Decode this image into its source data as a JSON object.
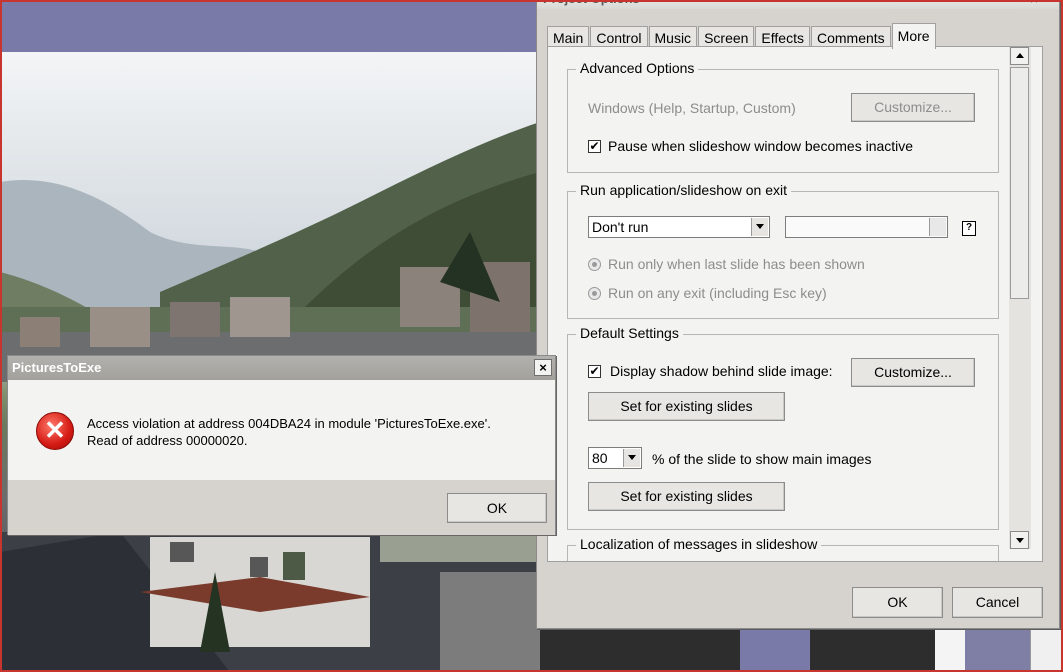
{
  "options_dialog": {
    "title": "Project Options",
    "tabs": [
      {
        "label": "Main"
      },
      {
        "label": "Control"
      },
      {
        "label": "Music"
      },
      {
        "label": "Screen"
      },
      {
        "label": "Effects"
      },
      {
        "label": "Comments"
      },
      {
        "label": "More",
        "active": true
      }
    ],
    "advanced_options": {
      "title": "Advanced Options",
      "windows_label": "Windows (Help, Startup, Custom)",
      "customize_label": "Customize...",
      "pause_checkbox_label": "Pause when slideshow window becomes inactive",
      "pause_checked": true
    },
    "run_on_exit": {
      "title": "Run application/slideshow on exit",
      "run_select_value": "Don't run",
      "path_value": "",
      "radio_last_slide": "Run only when last slide has been shown",
      "radio_any_exit": "Run on any exit (including Esc key)",
      "help_icon": "?"
    },
    "default_settings": {
      "title": "Default Settings",
      "shadow_checkbox_label": "Display shadow behind slide image:",
      "shadow_checked": true,
      "customize_label": "Customize...",
      "set_existing_1": "Set for existing slides",
      "percent_value": "80",
      "percent_label": "% of the slide to show main images",
      "set_existing_2": "Set for existing slides"
    },
    "localization": {
      "title": "Localization of messages in slideshow"
    },
    "ok_label": "OK",
    "cancel_label": "Cancel",
    "close_label": "×"
  },
  "error_dialog": {
    "title": "PicturesToExe",
    "close_label": "×",
    "icon_glyph": "✕",
    "message_line1": "Access violation at address 004DBA24 in module 'PicturesToExe.exe'.",
    "message_line2": "Read of address 00000020.",
    "ok_label": "OK"
  }
}
